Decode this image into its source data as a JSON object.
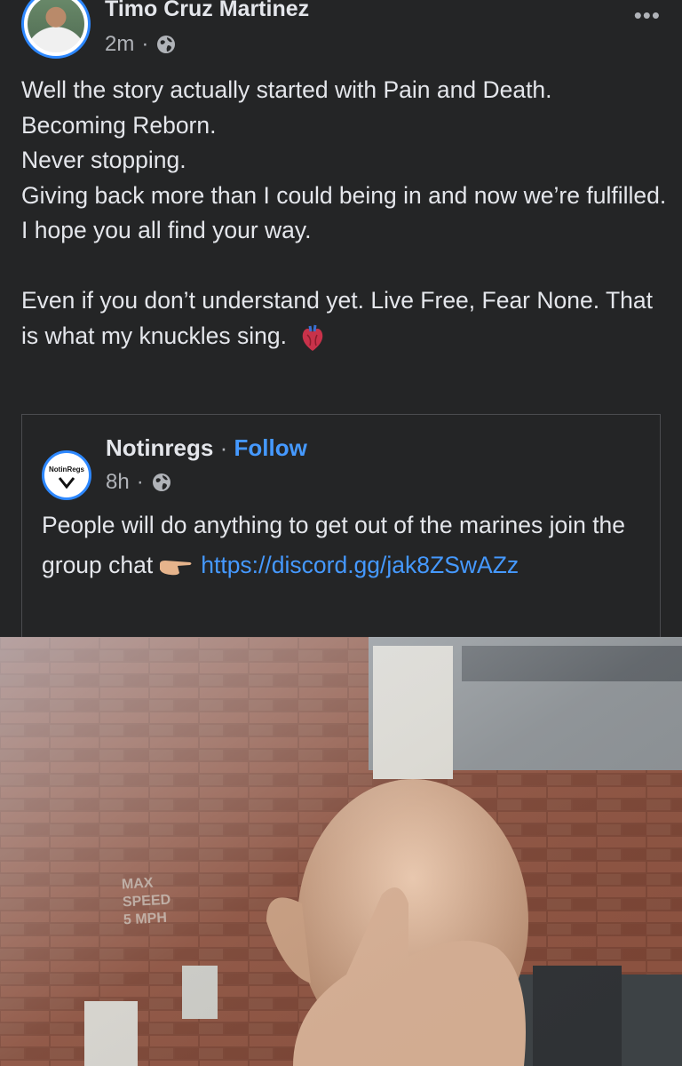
{
  "post": {
    "author": "Timo Cruz Martinez",
    "time": "2m",
    "separator": "·",
    "more": "•••",
    "lines": [
      "Well the story actually started with Pain and Death.",
      "Becoming Reborn.",
      "Never stopping.",
      "Giving back more than I could being in and now we’re fulfilled.",
      "I hope you all find your way."
    ],
    "paragraph2": "Even if you don’t understand yet. Live Free, Fear None. That is what my knuckles sing."
  },
  "shared": {
    "page_name": "Notinregs",
    "separator": "·",
    "follow": "Follow",
    "time": "8h",
    "logo_text": "NotinRegs",
    "text_before_link": "People will do anything to get out of the marines join the group chat",
    "link": "https://discord.gg/jak8ZSwAZz"
  },
  "photo": {
    "sign_lines": [
      "MAX",
      "SPEED",
      "5 MPH"
    ]
  },
  "colors": {
    "background": "#242526",
    "link": "#4599ff",
    "ring": "#2d88ff"
  }
}
